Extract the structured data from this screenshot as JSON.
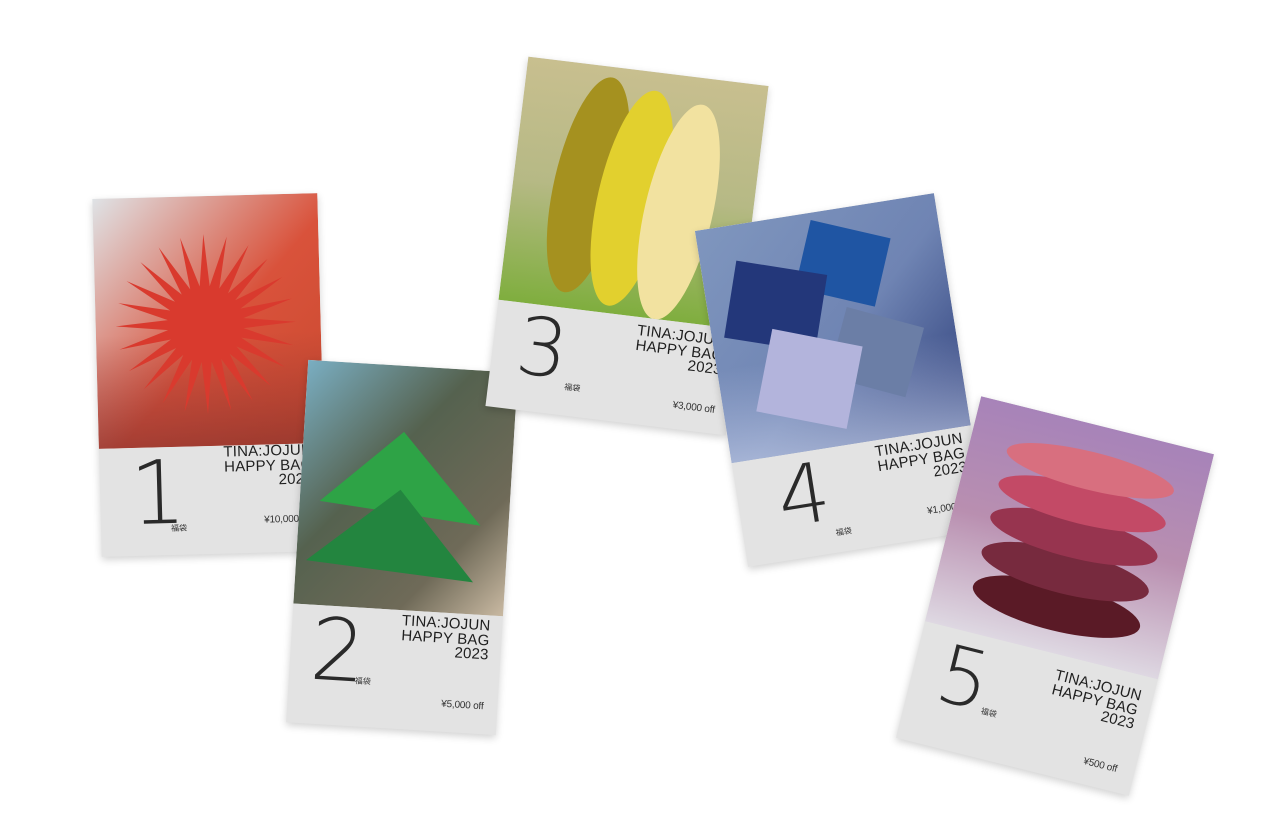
{
  "cards": [
    {
      "number": "1",
      "brand": "TINA:JOJUN",
      "line2": "HAPPY BAG",
      "year": "2023",
      "price": "¥10,000 off",
      "mark": "福袋"
    },
    {
      "number": "2",
      "brand": "TINA:JOJUN",
      "line2": "HAPPY BAG",
      "year": "2023",
      "price": "¥5,000 off",
      "mark": "福袋"
    },
    {
      "number": "3",
      "brand": "TINA:JOJUN",
      "line2": "HAPPY BAG",
      "year": "2023",
      "price": "¥3,000 off",
      "mark": "福袋"
    },
    {
      "number": "4",
      "brand": "TINA:JOJUN",
      "line2": "HAPPY BAG",
      "year": "2023",
      "price": "¥1,000 off",
      "mark": "福袋"
    },
    {
      "number": "5",
      "brand": "TINA:JOJUN",
      "line2": "HAPPY BAG",
      "year": "2023",
      "price": "¥500 off",
      "mark": "福袋"
    }
  ],
  "colors": {
    "background": "#ffffff",
    "card_base": "#e3e3e3",
    "card1_accent": "#d93a2e",
    "card2_accent": "#2e9a45",
    "card3_accent": "#e3d332",
    "card4_accent": "#23377a",
    "card5_accent": "#8c2a46"
  }
}
